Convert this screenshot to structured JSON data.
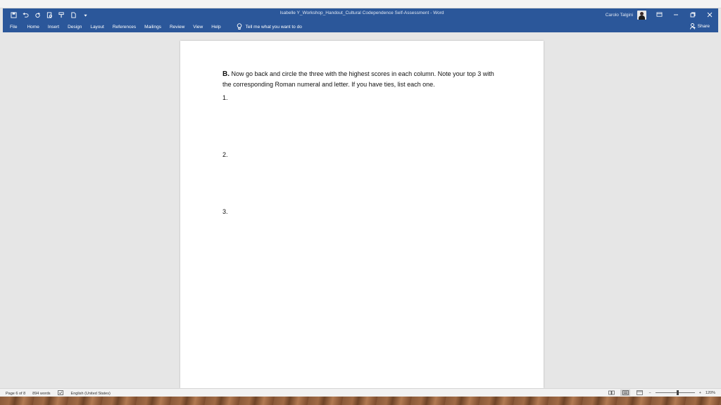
{
  "titlebar": {
    "doc_title": "Isabelle Y_Workshop_Handout_Cultural Codependence Self-Assessment  -  Word",
    "user_name": "Carolo Talgini",
    "qat_icons": [
      "save-icon",
      "undo-icon",
      "redo-icon",
      "print-preview-icon",
      "format-painter-icon",
      "new-document-icon",
      "customize-qat-icon"
    ],
    "window_controls": [
      "ribbon-display-icon",
      "minimize-icon",
      "restore-icon",
      "close-icon"
    ]
  },
  "menubar": {
    "tabs": [
      "File",
      "Home",
      "Insert",
      "Design",
      "Layout",
      "References",
      "Mailings",
      "Review",
      "View",
      "Help"
    ],
    "tell_me": "Tell me what you want to do",
    "share": "Share"
  },
  "document": {
    "section_letter": "B.",
    "instruction_text": "Now go back and circle the three with the highest scores in each column. Note your top 3 with the corresponding Roman numeral and letter. If you have ties, list each one.",
    "items": [
      "1.",
      "2.",
      "3."
    ]
  },
  "statusbar": {
    "page": "Page 6 of 8",
    "words": "894 words",
    "language": "English (United States)",
    "zoom": "120%",
    "zoom_minus": "−",
    "zoom_plus": "+"
  },
  "colors": {
    "ribbon_blue": "#2b579a",
    "canvas_gray": "#e6e6e6"
  }
}
